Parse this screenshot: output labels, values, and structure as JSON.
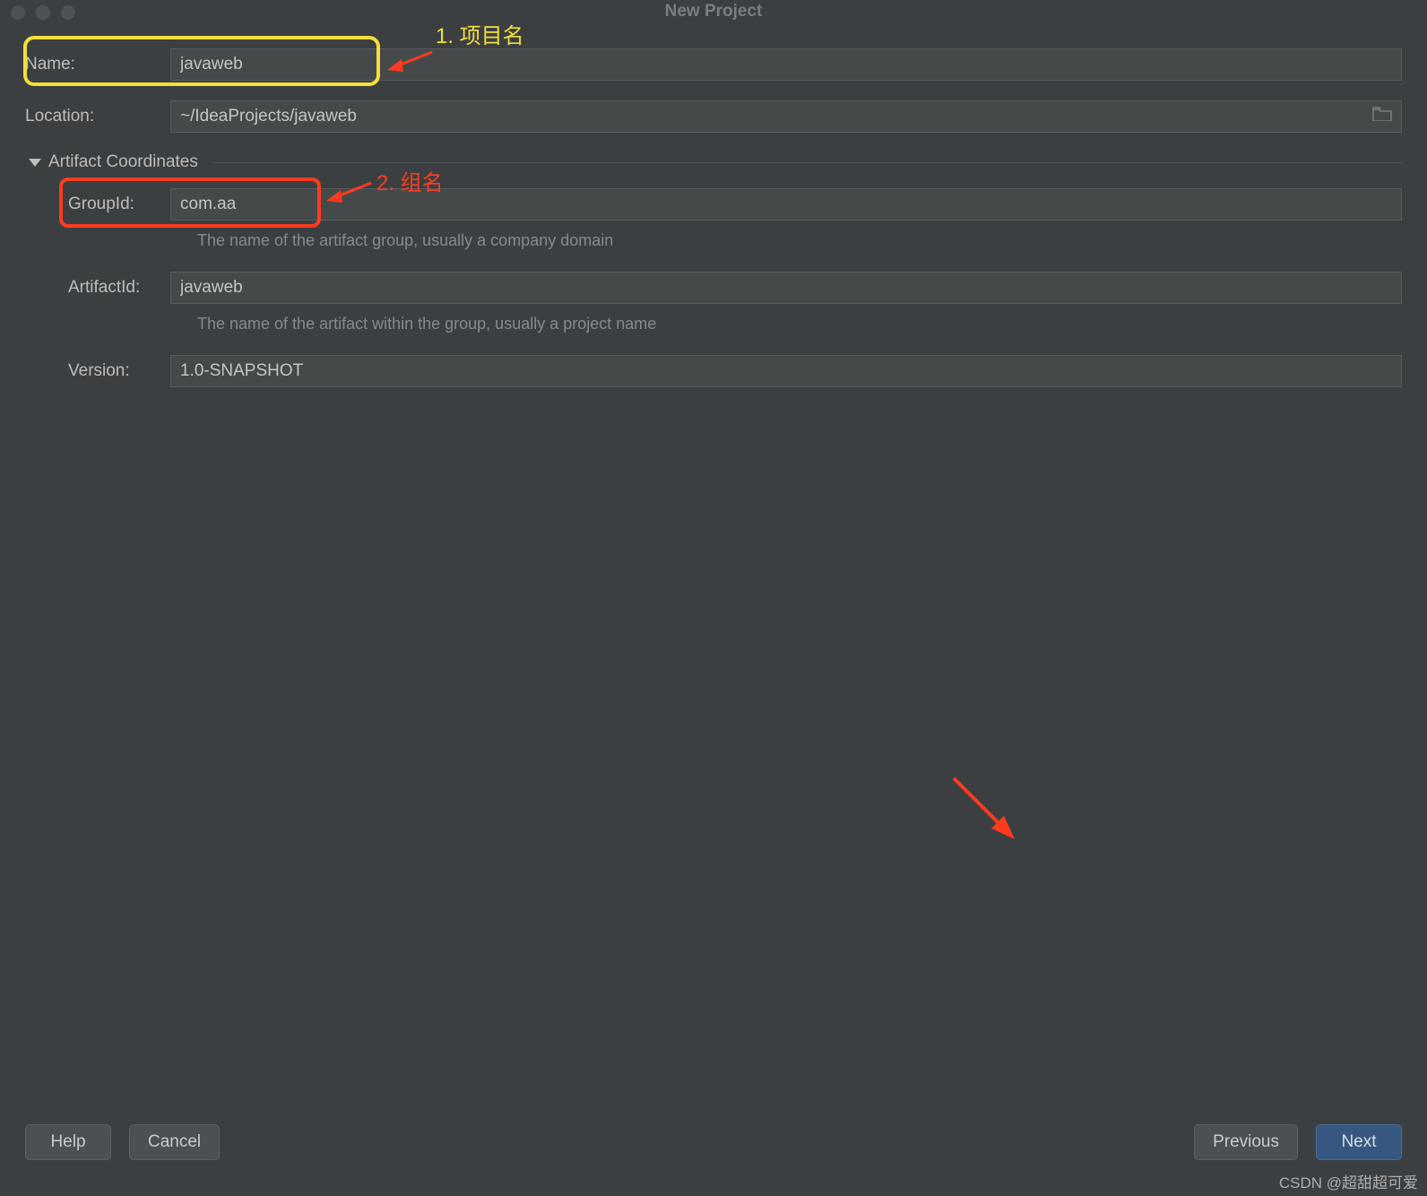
{
  "window": {
    "title": "New Project"
  },
  "fields": {
    "name_label": "Name:",
    "name_value": "javaweb",
    "location_label": "Location:",
    "location_value": "~/IdeaProjects/javaweb"
  },
  "artifact": {
    "section_title": "Artifact Coordinates",
    "group_label": "GroupId:",
    "group_value": "com.aa",
    "group_hint": "The name of the artifact group, usually a company domain",
    "artifact_label": "ArtifactId:",
    "artifact_value": "javaweb",
    "artifact_hint": "The name of the artifact within the group, usually a project name",
    "version_label": "Version:",
    "version_value": "1.0-SNAPSHOT"
  },
  "buttons": {
    "help": "Help",
    "cancel": "Cancel",
    "previous": "Previous",
    "next": "Next"
  },
  "annotations": {
    "project_name": "1. 项目名",
    "group_name": "2. 组名"
  },
  "watermark": "CSDN @超甜超可爱"
}
